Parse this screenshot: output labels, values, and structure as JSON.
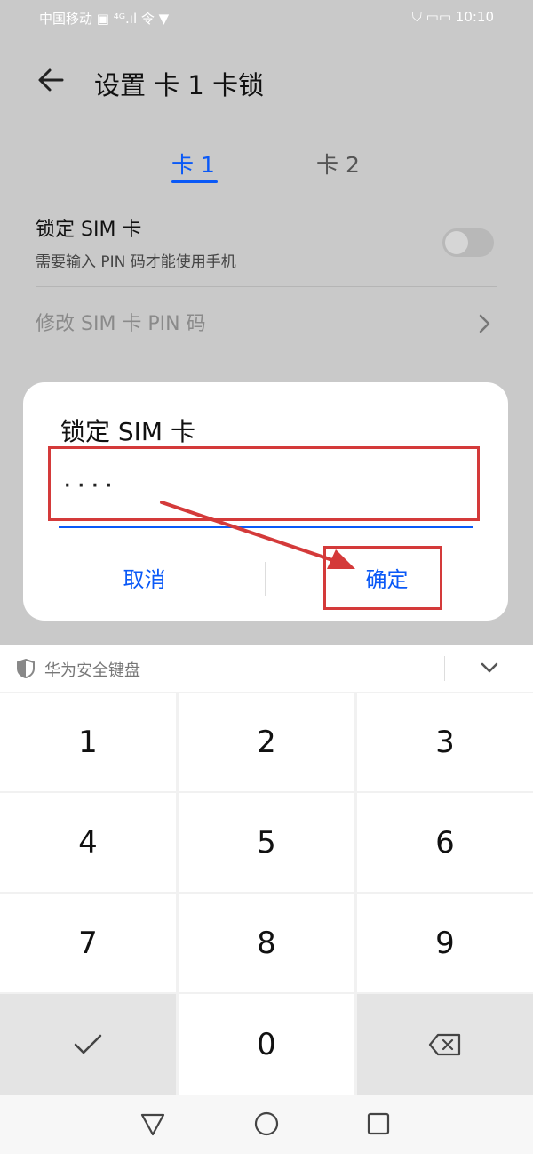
{
  "status_bar": {
    "left": "中国移动 ▣ ⁴ᴳ.ıl 令 ▼",
    "right": "⛉ ▭▭ 10:10"
  },
  "header": {
    "title": "设置 卡 1 卡锁",
    "back_icon": "arrow-left-icon"
  },
  "tabs": [
    {
      "label": "卡 1",
      "active": true
    },
    {
      "label": "卡 2",
      "active": false
    }
  ],
  "settings": {
    "lock_sim": {
      "title": "锁定 SIM 卡",
      "subtitle": "需要输入 PIN 码才能使用手机",
      "enabled": false
    },
    "change_pin": {
      "title": "修改 SIM 卡 PIN 码"
    }
  },
  "dialog": {
    "title": "锁定 SIM 卡",
    "pin_value": "····",
    "cancel_label": "取消",
    "confirm_label": "确定"
  },
  "keyboard": {
    "header_label": "华为安全键盘",
    "keys": [
      "1",
      "2",
      "3",
      "4",
      "5",
      "6",
      "7",
      "8",
      "9",
      "✓",
      "0",
      "⌫"
    ]
  },
  "colors": {
    "accent": "#0a59f7",
    "annotation": "#d43a3a"
  }
}
